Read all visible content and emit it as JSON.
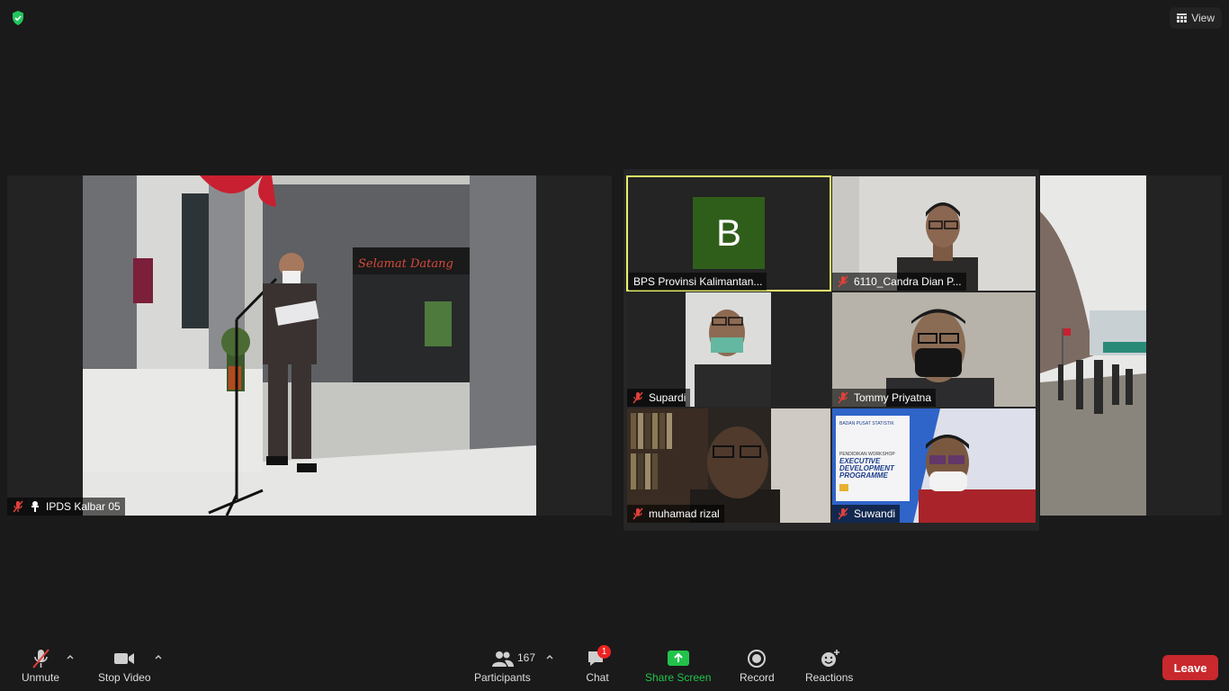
{
  "topbar": {
    "view_label": "View"
  },
  "speaker": {
    "name": "IPDS Kalbar 05",
    "sign_text": "Selamat Datang"
  },
  "gallery": {
    "tiles": [
      {
        "name": "BPS Provinsi Kalimantan...",
        "avatar_letter": "B"
      },
      {
        "name": "6110_Candra Dian P..."
      },
      {
        "name": "Supardi"
      },
      {
        "name": "Tommy Priyatna"
      },
      {
        "name": "muhamad rizal"
      },
      {
        "name": "Suwandi"
      }
    ]
  },
  "banner": {
    "line1": "BADAN PUSAT STATISTIK",
    "line2": "PENDIDIKAN WORKSHOP",
    "line3": "EXECUTIVE",
    "line4": "DEVELOPMENT",
    "line5": "PROGRAMME"
  },
  "toolbar": {
    "unmute": "Unmute",
    "stop_video": "Stop Video",
    "participants": "Participants",
    "participants_count": "167",
    "chat": "Chat",
    "chat_badge": "1",
    "share_screen": "Share Screen",
    "record": "Record",
    "reactions": "Reactions",
    "leave": "Leave"
  },
  "colors": {
    "active_speaker": "#e8f06b",
    "share_green": "#22c34a",
    "leave_red": "#c9282d",
    "avatar_green": "#2f5e1b"
  }
}
